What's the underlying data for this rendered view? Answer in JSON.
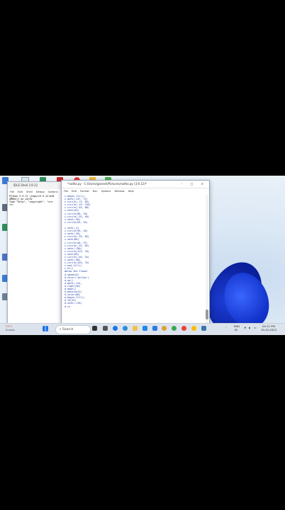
{
  "shell": {
    "title": "IDLE Shell 3.9.12",
    "menu": [
      "File",
      "Edit",
      "Shell",
      "Debug",
      "Options",
      "Wi"
    ],
    "lines": [
      "Python 3.9.12 (tags/v3.9.12:b28",
      "AMD64)] on win32",
      "Type \"help\", \"copyright\", \"cre",
      ">>>"
    ]
  },
  "editor": {
    "title": "*radha.py - C:/Users/ganesh/Pictures/radha.py (3.9.12)*",
    "menu": [
      "File",
      "Edit",
      "Format",
      "Run",
      "Options",
      "Window",
      "Help"
    ],
    "window_controls": "–  ▢  ✕",
    "code_lines": [
      "c.begin_fill()",
      "c.goto(-147, 72)",
      "c.circle(-72, 85)",
      "c.circle(-19, 195)",
      "c.circle(-45, 80)",
      "c.seth(45)",
      "c.circle(85, 20)",
      "c.circle(-35, 40)",
      "c.seth(-50)",
      "c.circle(55, 55)",
      "",
      "c.seth(-4)",
      "c.circle(95, 26)",
      "c.seth(-40)",
      "c.circle(-35, 85)",
      "c.seth(80)",
      "c.circle(40, 37)",
      "c.circle(-25, 85)",
      "c.seth(-150)",
      "c.circle(115, 70)",
      "c.seth(90)",
      "c.circle(-40, 24)",
      "c.seth(-60)",
      "c.circle(155, 75)",
      "c.end_fill()",
      "c.ht()",
      "#draw the flower",
      "d.speed(0)",
      "d.color('yellow')",
      "d.up()",
      "d.goto(-114,",
      "d.right(30)",
      "d.down()",
      "d.pensize(3)",
      "d.color(80)",
      "d.begin_fill()",
      "d.fd(15)",
      "d.seth(-170)",
      "d.cs"
    ]
  },
  "taskbar": {
    "weather_temp": "33°C",
    "weather_desc": "Smoke",
    "search_label": "Search",
    "lang": "ENG",
    "lang_region": "IN",
    "time": "04:11 PM",
    "date": "19-10-2023"
  },
  "colors": {
    "accent": "#0b2fc9",
    "taskbar": "#dce3ec"
  },
  "icons": [
    "windows-start-icon",
    "search-icon",
    "taskview-icon",
    "edge-icon",
    "folder-icon",
    "vscode-icon",
    "chrome-icon",
    "python-icon",
    "wifi-icon",
    "volume-icon",
    "battery-icon"
  ]
}
